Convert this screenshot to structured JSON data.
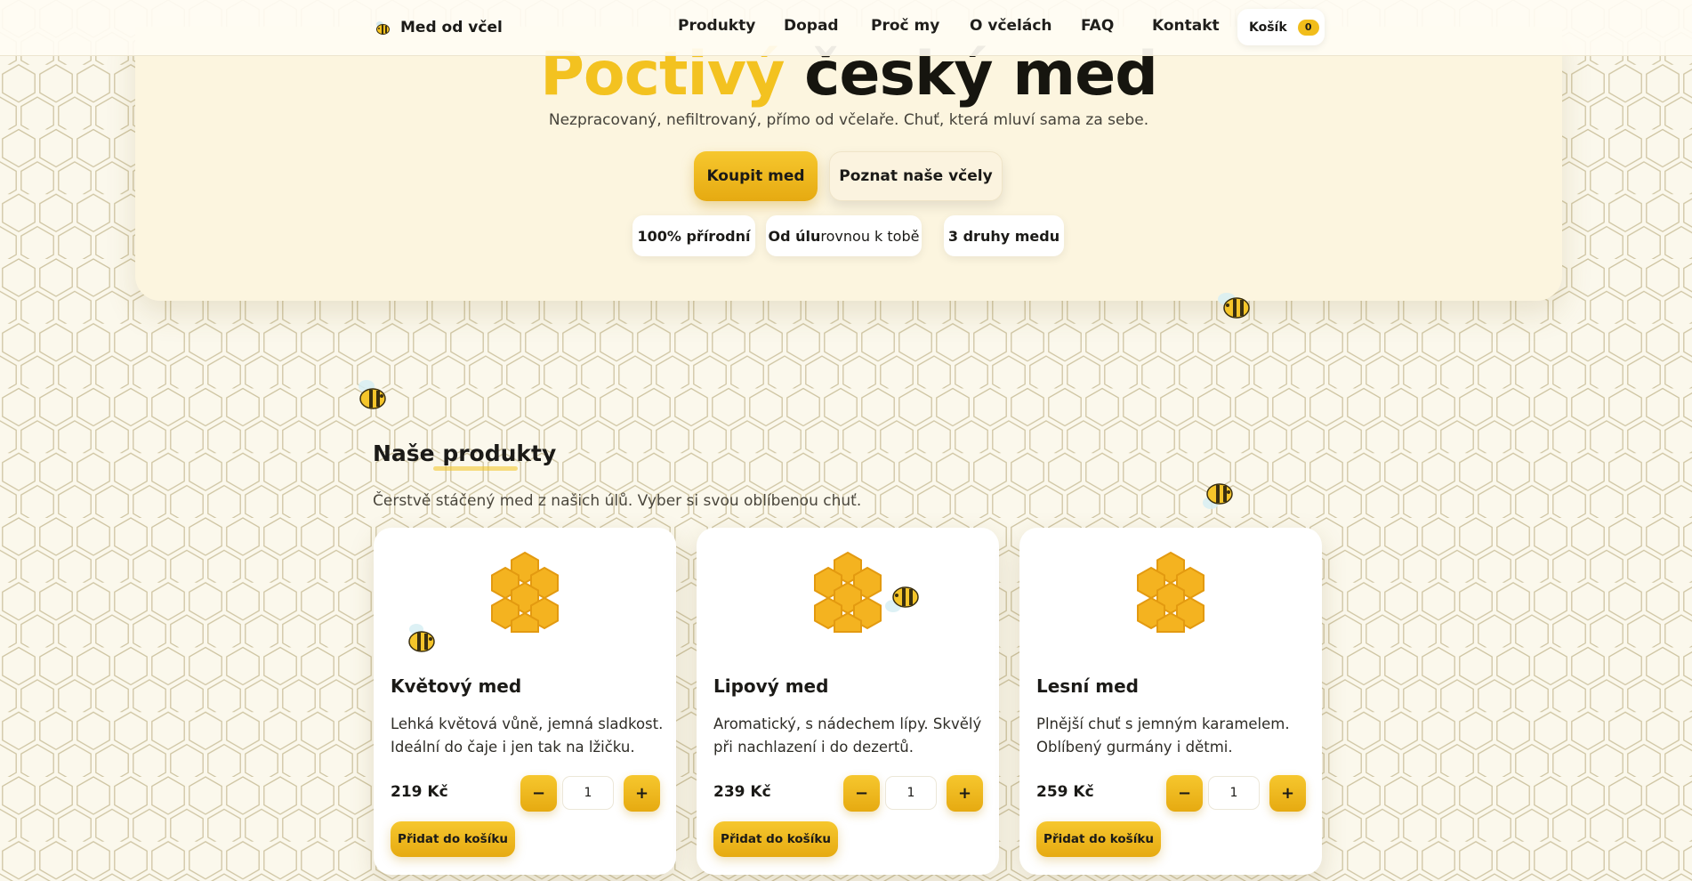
{
  "nav": {
    "brand": "Med od včel",
    "brand_icon": "bee-icon",
    "links": [
      "Produkty",
      "Dopad",
      "Proč my",
      "O včelách",
      "FAQ",
      "Kontakt"
    ],
    "cart_label": "Košík",
    "cart_count": "0"
  },
  "hero": {
    "title_accent": "Poctivý",
    "title_rest": "český med",
    "subtitle": "Nezpracovaný, nefiltrovaný, přímo od včelaře. Chuť, která mluví sama za sebe.",
    "primary_button": "Koupit med",
    "secondary_button": "Poznat naše včely",
    "chips": [
      {
        "bold": "100% přírodní",
        "rest": ""
      },
      {
        "bold": "Od úlu",
        "rest": " rovnou k tobě"
      },
      {
        "bold": "3 druhy medu",
        "rest": ""
      }
    ]
  },
  "products": {
    "title": "Naše produkty",
    "subtitle": "Čerstvě stáčený med z našich úlů. Vyber si svou oblíbenou chuť.",
    "items": [
      {
        "name": "Květový med",
        "description": "Lehká květová vůně, jemná sladkost. Ideální do čaje i jen tak na lžičku.",
        "price": "219 Kč",
        "qty": "1",
        "add_label": "Přidat do košíku"
      },
      {
        "name": "Lipový med",
        "description": "Aromatický, s nádechem lípy. Skvělý při nachlazení i do dezertů.",
        "price": "239 Kč",
        "qty": "1",
        "add_label": "Přidat do košíku"
      },
      {
        "name": "Lesní med",
        "description": "Plnější chuť s jemným karamelem. Oblíbený gurmány i dětmi.",
        "price": "259 Kč",
        "qty": "1",
        "add_label": "Přidat do košíku"
      }
    ],
    "minus_label": "−",
    "plus_label": "+"
  },
  "colors": {
    "accent": "#f3c220",
    "button": "#f0b81c",
    "background": "#fbf8ec",
    "text": "#1b1a17"
  }
}
